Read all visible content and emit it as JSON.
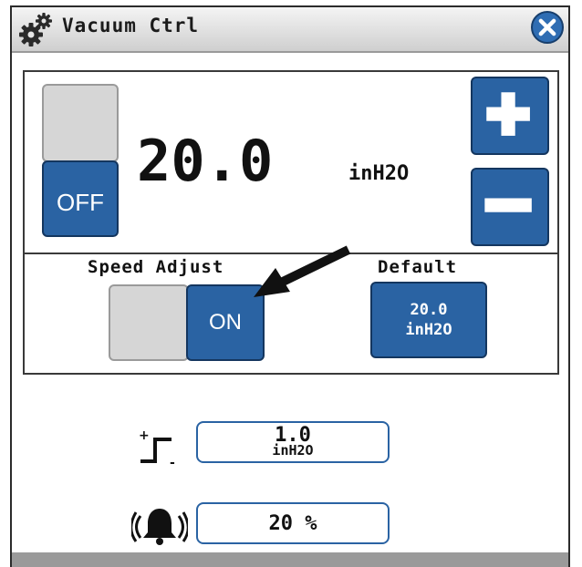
{
  "window": {
    "title": "Vacuum Ctrl",
    "icons": {
      "title": "gears-icon",
      "close": "close-icon"
    }
  },
  "setpoint": {
    "value": "20.0",
    "unit": "inH2O",
    "mode_button_label": "OFF",
    "increase_icon": "plus-icon",
    "decrease_icon": "minus-icon"
  },
  "speed_adjust": {
    "label": "Speed Adjust",
    "state_label": "ON"
  },
  "default": {
    "label": "Default",
    "value": "20.0",
    "unit": "inH2O"
  },
  "step": {
    "icon": "step-increment-icon",
    "value": "1.0",
    "unit": "inH2O"
  },
  "alarm": {
    "icon": "alarm-bell-icon",
    "value": "20 %"
  },
  "colors": {
    "accent_blue": "#2a63a3",
    "toggle_gray": "#d6d6d6"
  }
}
